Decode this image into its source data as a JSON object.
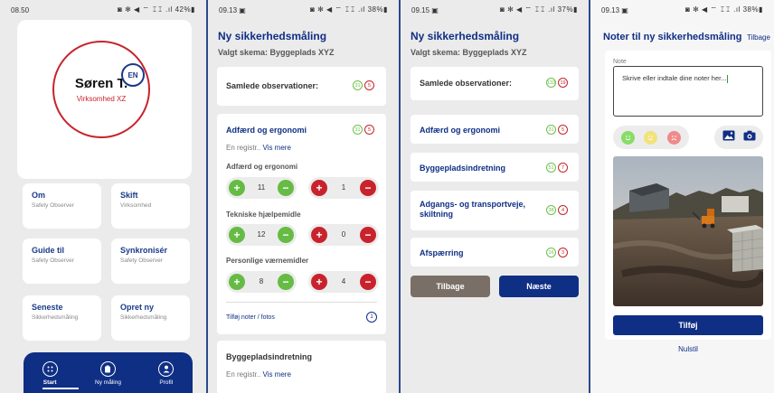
{
  "screen1": {
    "status": {
      "time": "08.50",
      "icons": "◙ ✻ ◀ ⌔ 𝙸𝙸 .ıl 42%▮"
    },
    "lang": "EN",
    "user": {
      "name": "Søren T.",
      "company": "Virksomhed XZ"
    },
    "tiles": [
      {
        "title": "Om",
        "sub": "Safety Observer"
      },
      {
        "title": "Skift",
        "sub": "Virksomhed"
      },
      {
        "title": "Guide til",
        "sub": "Safety Observer"
      },
      {
        "title": "Synkronisér",
        "sub": "Safety Observer"
      },
      {
        "title": "Seneste",
        "sub": "Sikkerhedsmåling"
      },
      {
        "title": "Opret ny",
        "sub": "Sikkerhedsmåling"
      }
    ],
    "nav": [
      {
        "label": "Start",
        "icon": "grid-icon"
      },
      {
        "label": "Ny måling",
        "icon": "clipboard-icon"
      },
      {
        "label": "Profil",
        "icon": "user-icon"
      }
    ]
  },
  "screen2": {
    "status": {
      "time": "09.13 ▣",
      "icons": "◙ ✻ ◀ ⌔ 𝙸𝙸 .ıl 38%▮"
    },
    "title": "Ny sikkerhedsmåling",
    "subtitle": "Valgt skema: Byggeplads XYZ",
    "summary": {
      "label": "Samlede observationer:",
      "green": "31",
      "red": "5"
    },
    "category": {
      "title": "Adfærd og ergonomi",
      "green": "31",
      "red": "5",
      "reg_text": "En registr..",
      "more": "Vis mere",
      "items": [
        {
          "label": "Adfærd og ergonomi",
          "positive": "11",
          "negative": "1"
        },
        {
          "label": "Tekniske hjælpemidle",
          "positive": "12",
          "negative": "0"
        },
        {
          "label": "Personlige værnemidler",
          "positive": "8",
          "negative": "4"
        }
      ],
      "notes_link": "Tilføj noter / fotos"
    },
    "category2": {
      "title": "Byggepladsindretning",
      "reg_text": "En registr..",
      "more": "Vis mere"
    }
  },
  "screen3": {
    "status": {
      "time": "09.15 ▣",
      "icons": "◙ ✻ ◀ ⌔ 𝙸𝙸 .ıl 37%▮"
    },
    "title": "Ny sikkerhedsmåling",
    "subtitle": "Valgt skema: Byggeplads XYZ",
    "summary": {
      "label": "Samlede observationer:",
      "green": "133",
      "red": "19"
    },
    "categories": [
      {
        "title": "Adfærd og ergonomi",
        "green": "31",
        "red": "5"
      },
      {
        "title": "Byggepladsindretning",
        "green": "51",
        "red": "7"
      },
      {
        "title": "Adgangs- og transportveje, skiltning",
        "green": "38",
        "red": "4"
      },
      {
        "title": "Afspærring",
        "green": "16",
        "red": "3"
      }
    ],
    "back_label": "Tilbage",
    "next_label": "Næste"
  },
  "screen4": {
    "status": {
      "time": "09.13 ▣",
      "icons": "◙ ✻ ◀ ⌔ 𝙸𝙸 .ıl 38%▮"
    },
    "title": "Noter til ny sikkerhedsmåling",
    "back_label": "Tilbage",
    "note_label": "Note",
    "note_placeholder": "Skrive eller indtale dine noter her...",
    "add_label": "Tilføj",
    "reset_label": "Nulstil"
  }
}
